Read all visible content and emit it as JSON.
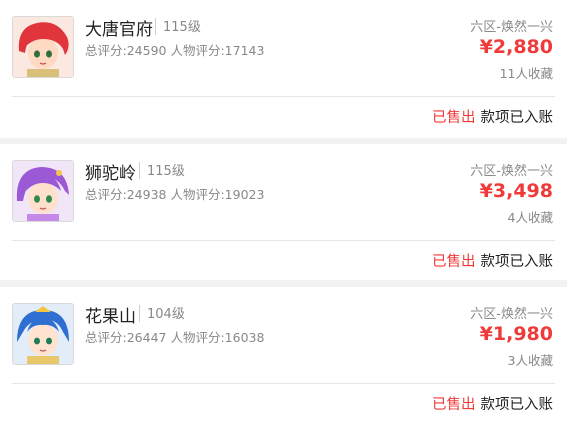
{
  "listings": [
    {
      "school": "大唐官府",
      "level": "115级",
      "score_text": "总评分:24590 人物评分:17143",
      "server": "六区-焕然一兴",
      "price": "¥2,880",
      "favorites": "11人收藏",
      "status": "已售出",
      "status_note": "款项已入账",
      "hair_color": "#e0353a"
    },
    {
      "school": "狮驼岭",
      "level": "115级",
      "score_text": "总评分:24938 人物评分:19023",
      "server": "六区-焕然一兴",
      "price": "¥3,498",
      "favorites": "4人收藏",
      "status": "已售出",
      "status_note": "款项已入账",
      "hair_color": "#9b59d6"
    },
    {
      "school": "花果山",
      "level": "104级",
      "score_text": "总评分:26447 人物评分:16038",
      "server": "六区-焕然一兴",
      "price": "¥1,980",
      "favorites": "3人收藏",
      "status": "已售出",
      "status_note": "款项已入账",
      "hair_color": "#2f6fd1"
    }
  ],
  "colors": {
    "price_red": "#f03a3a",
    "muted_gray": "#888888",
    "background": "#f2f2f2"
  }
}
